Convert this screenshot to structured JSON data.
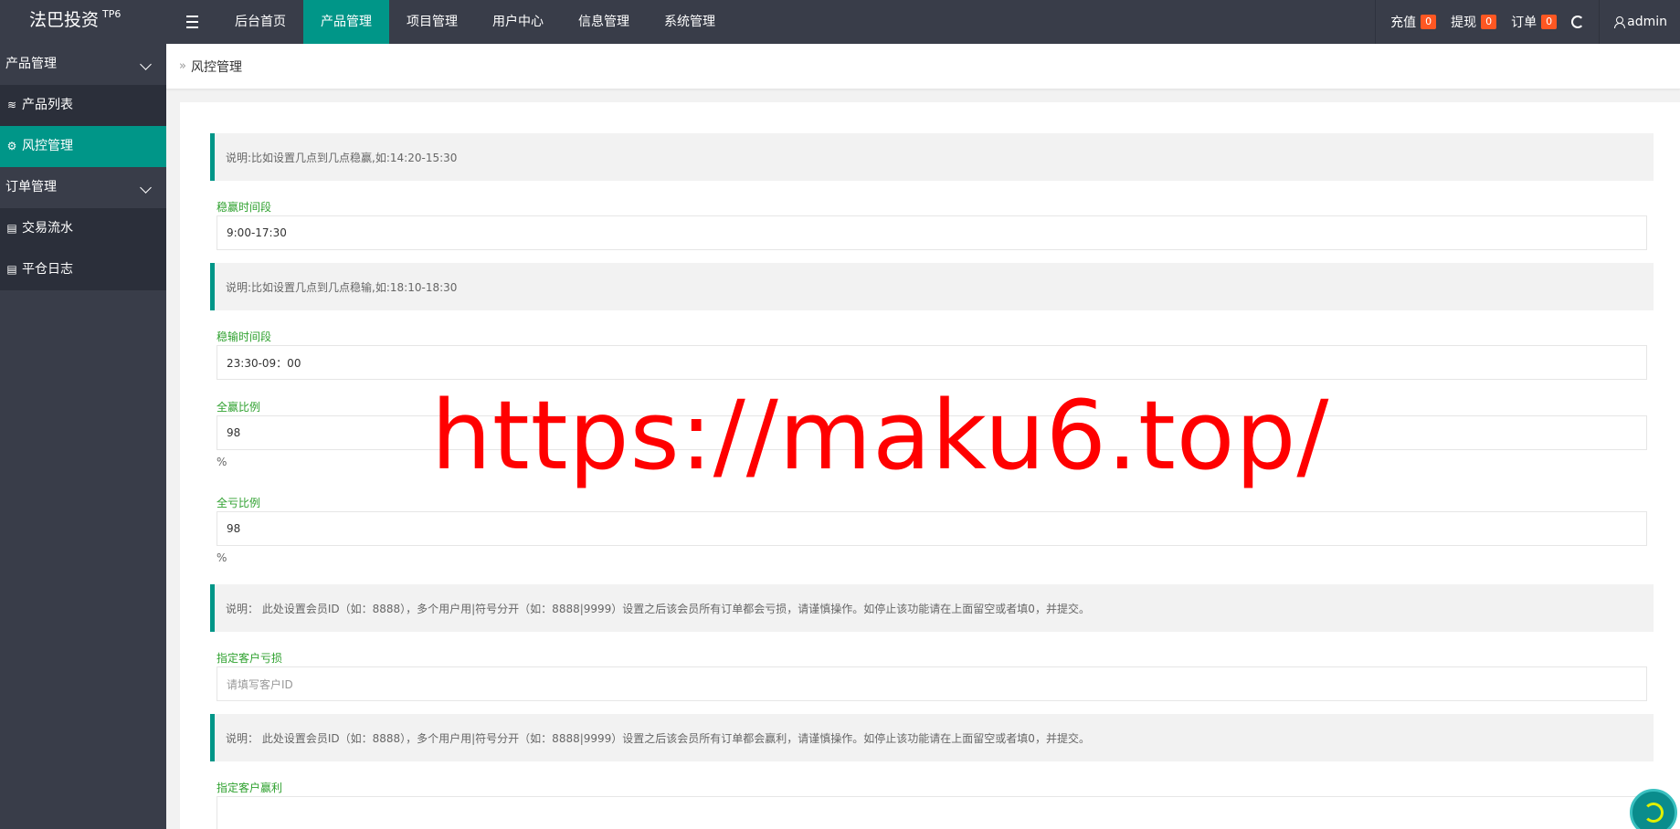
{
  "app": {
    "logo": "法巴投资",
    "logo_sup": "TP6"
  },
  "nav": {
    "items": [
      {
        "label": "后台首页",
        "active": false
      },
      {
        "label": "产品管理",
        "active": true
      },
      {
        "label": "项目管理",
        "active": false
      },
      {
        "label": "用户中心",
        "active": false
      },
      {
        "label": "信息管理",
        "active": false
      },
      {
        "label": "系统管理",
        "active": false
      }
    ]
  },
  "right_nav": {
    "recharge": {
      "label": "充值",
      "count": "0"
    },
    "withdraw": {
      "label": "提现",
      "count": "0"
    },
    "orders": {
      "label": "订单",
      "count": "0"
    },
    "user": "admin"
  },
  "sidebar": {
    "group1": "产品管理",
    "item_product_list": "产品列表",
    "item_risk": "风控管理",
    "group2": "订单管理",
    "item_trade_flow": "交易流水",
    "item_close_log": "平仓日志"
  },
  "breadcrumb": {
    "current": "风控管理"
  },
  "form": {
    "note1": "说明:比如设置几点到几点稳赢,如:14:20-15:30",
    "win_period_label": "稳赢时间段",
    "win_period_value": "9:00-17:30",
    "note2": "说明:比如设置几点到几点稳输,如:18:10-18:30",
    "lose_period_label": "稳输时间段",
    "lose_period_value": "23:30-09：00",
    "all_win_label": "全赢比例",
    "all_win_value": "98",
    "all_win_unit": "%",
    "all_lose_label": "全亏比例",
    "all_lose_value": "98",
    "all_lose_unit": "%",
    "note3": "说明： 此处设置会员ID（如：8888），多个用户用|符号分开（如：8888|9999）设置之后该会员所有订单都会亏损，请谨慎操作。如停止该功能请在上面留空或者填0，并提交。",
    "lose_customer_label": "指定客户亏损",
    "lose_customer_placeholder": "请填写客户ID",
    "note4": "说明： 此处设置会员ID（如：8888），多个用户用|符号分开（如：8888|9999）设置之后该会员所有订单都会赢利，请谨慎操作。如停止该功能请在上面留空或者填0，并提交。",
    "win_customer_label": "指定客户赢利"
  },
  "watermark": "https://maku6.top/",
  "colors": {
    "header": "#393d49",
    "accent": "#009688",
    "badge": "#ff5722",
    "label": "#2fa12f"
  }
}
